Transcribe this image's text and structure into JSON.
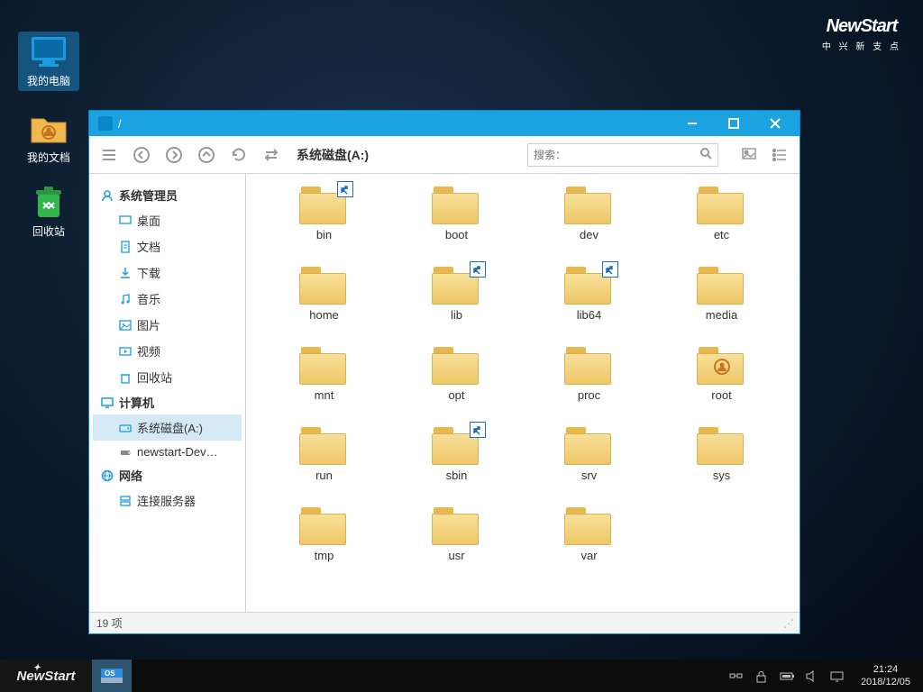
{
  "desktop": {
    "icons": [
      {
        "name": "my-computer",
        "label": "我的电脑",
        "selected": true
      },
      {
        "name": "my-documents",
        "label": "我的文档",
        "selected": false
      },
      {
        "name": "recycle-bin",
        "label": "回收站",
        "selected": false
      }
    ]
  },
  "brand": {
    "title": "NewStart",
    "subtitle": "中 兴 新 支 点"
  },
  "window": {
    "title_path": "/",
    "location_label": "系统磁盘(A:)",
    "search_placeholder": "搜索：",
    "status": "19 项"
  },
  "sidebar": {
    "user_header": "系统管理员",
    "user_items": [
      {
        "icon": "desktop",
        "label": "桌面"
      },
      {
        "icon": "doc",
        "label": "文档"
      },
      {
        "icon": "download",
        "label": "下载"
      },
      {
        "icon": "music",
        "label": "音乐"
      },
      {
        "icon": "picture",
        "label": "图片"
      },
      {
        "icon": "video",
        "label": "视频"
      },
      {
        "icon": "trash",
        "label": "回收站"
      }
    ],
    "computer_header": "计算机",
    "computer_items": [
      {
        "icon": "disk",
        "label": "系统磁盘(A:)",
        "selected": true
      },
      {
        "icon": "usb",
        "label": "newstart-Dev…",
        "selected": false
      }
    ],
    "network_header": "网络",
    "network_items": [
      {
        "icon": "server",
        "label": "连接服务器"
      }
    ]
  },
  "folders": [
    {
      "name": "bin",
      "link": true
    },
    {
      "name": "boot"
    },
    {
      "name": "dev"
    },
    {
      "name": "etc"
    },
    {
      "name": "home"
    },
    {
      "name": "lib",
      "link": true
    },
    {
      "name": "lib64",
      "link": true
    },
    {
      "name": "media"
    },
    {
      "name": "mnt"
    },
    {
      "name": "opt"
    },
    {
      "name": "proc"
    },
    {
      "name": "root",
      "user": true
    },
    {
      "name": "run"
    },
    {
      "name": "sbin",
      "link": true
    },
    {
      "name": "srv"
    },
    {
      "name": "sys"
    },
    {
      "name": "tmp"
    },
    {
      "name": "usr"
    },
    {
      "name": "var"
    }
  ],
  "taskbar": {
    "start": "NewStart",
    "app": "OS",
    "time": "21:24",
    "date": "2018/12/05"
  }
}
